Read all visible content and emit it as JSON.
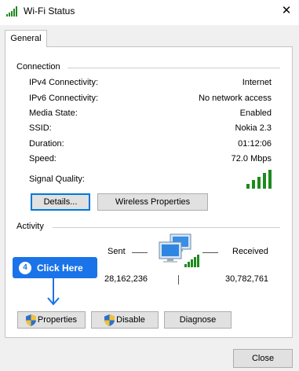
{
  "window": {
    "title": "Wi-Fi Status",
    "close_glyph": "✕"
  },
  "tabs": [
    {
      "label": "General"
    }
  ],
  "connection": {
    "group_label": "Connection",
    "rows": [
      {
        "label": "IPv4 Connectivity:",
        "value": "Internet"
      },
      {
        "label": "IPv6 Connectivity:",
        "value": "No network access"
      },
      {
        "label": "Media State:",
        "value": "Enabled"
      },
      {
        "label": "SSID:",
        "value": "Nokia 2.3"
      },
      {
        "label": "Duration:",
        "value": "01:12:06"
      },
      {
        "label": "Speed:",
        "value": "72.0 Mbps"
      }
    ],
    "signal_label": "Signal Quality:",
    "signal_level": "5/5",
    "details_button": "Details...",
    "wireless_button": "Wireless Properties"
  },
  "activity": {
    "group_label": "Activity",
    "sent_label": "Sent",
    "received_label": "Received",
    "sent_value": "28,162,236",
    "received_value": "30,782,761",
    "properties_button": "Properties",
    "disable_button": "Disable",
    "diagnose_button": "Diagnose"
  },
  "callout": {
    "step": "4",
    "text": "Click Here",
    "color": "#1a73e8"
  },
  "footer": {
    "close_button": "Close"
  },
  "icons": {
    "title": "wifi-signal-icon",
    "signal": "signal-bars-icon",
    "network": "network-computers-icon",
    "shield": "uac-shield-icon"
  }
}
